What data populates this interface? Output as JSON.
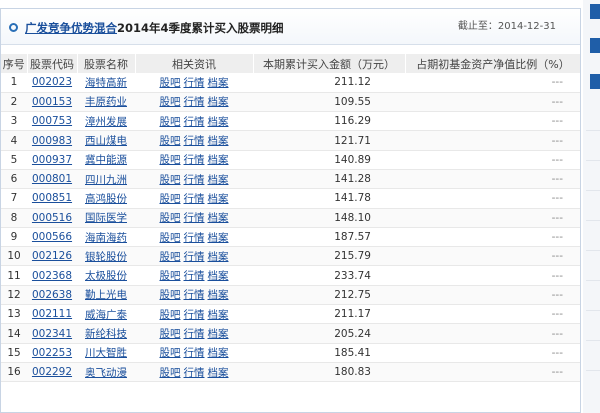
{
  "header": {
    "fund_name": "广发竞争优势混合",
    "title": "2014年4季度累计买入股票明细",
    "cutoff": "截止至：2014-12-31"
  },
  "table": {
    "columns": [
      "序号",
      "股票代码",
      "股票名称",
      "相关资讯",
      "本期累计买入金额（万元）",
      "占期初基金资产净值比例（%）"
    ],
    "link_labels": [
      "股吧",
      "行情",
      "档案"
    ],
    "rows": [
      {
        "idx": "1",
        "code": "002023",
        "name": "海特高新",
        "amount": "211.12",
        "ratio": "---"
      },
      {
        "idx": "2",
        "code": "000153",
        "name": "丰原药业",
        "amount": "109.55",
        "ratio": "---"
      },
      {
        "idx": "3",
        "code": "000753",
        "name": "漳州发展",
        "amount": "116.29",
        "ratio": "---"
      },
      {
        "idx": "4",
        "code": "000983",
        "name": "西山煤电",
        "amount": "121.71",
        "ratio": "---"
      },
      {
        "idx": "5",
        "code": "000937",
        "name": "冀中能源",
        "amount": "140.89",
        "ratio": "---"
      },
      {
        "idx": "6",
        "code": "000801",
        "name": "四川九洲",
        "amount": "141.28",
        "ratio": "---"
      },
      {
        "idx": "7",
        "code": "000851",
        "name": "高鸿股份",
        "amount": "141.78",
        "ratio": "---"
      },
      {
        "idx": "8",
        "code": "000516",
        "name": "国际医学",
        "amount": "148.10",
        "ratio": "---"
      },
      {
        "idx": "9",
        "code": "000566",
        "name": "海南海药",
        "amount": "187.57",
        "ratio": "---"
      },
      {
        "idx": "10",
        "code": "002126",
        "name": "银轮股份",
        "amount": "215.79",
        "ratio": "---"
      },
      {
        "idx": "11",
        "code": "002368",
        "name": "太极股份",
        "amount": "233.74",
        "ratio": "---"
      },
      {
        "idx": "12",
        "code": "002638",
        "name": "勤上光电",
        "amount": "212.75",
        "ratio": "---"
      },
      {
        "idx": "13",
        "code": "002111",
        "name": "威海广泰",
        "amount": "211.17",
        "ratio": "---"
      },
      {
        "idx": "14",
        "code": "002341",
        "name": "新纶科技",
        "amount": "205.24",
        "ratio": "---"
      },
      {
        "idx": "15",
        "code": "002253",
        "name": "川大智胜",
        "amount": "185.41",
        "ratio": "---"
      },
      {
        "idx": "16",
        "code": "002292",
        "name": "奥飞动漫",
        "amount": "180.83",
        "ratio": "---"
      }
    ]
  },
  "colors": {
    "link": "#1a4f9c",
    "header_bg": "#eeeeee",
    "accent": "#1f5ea8"
  },
  "icons": {
    "header_marker": "circle-icon"
  }
}
